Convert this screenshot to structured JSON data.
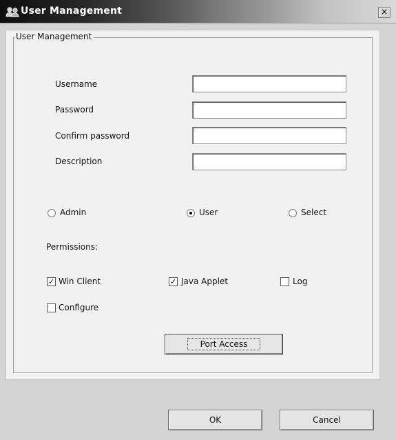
{
  "window": {
    "title": "User Management",
    "close_glyph": "×",
    "icon": "users-icon"
  },
  "group": {
    "legend": "User Management"
  },
  "fields": [
    {
      "label": "Username",
      "value": ""
    },
    {
      "label": "Password",
      "value": ""
    },
    {
      "label": "Confirm password",
      "value": ""
    },
    {
      "label": "Description",
      "value": ""
    }
  ],
  "roles": [
    {
      "label": "Admin",
      "selected": false
    },
    {
      "label": "User",
      "selected": true
    },
    {
      "label": "Select",
      "selected": false
    }
  ],
  "permissions": {
    "title": "Permissions:",
    "items": [
      {
        "label": "Win Client",
        "checked": true
      },
      {
        "label": "Java Applet",
        "checked": true
      },
      {
        "label": "Log",
        "checked": false
      },
      {
        "label": "Configure",
        "checked": false
      }
    ]
  },
  "port_access_label": "Port Access",
  "buttons": {
    "ok": "OK",
    "cancel": "Cancel"
  },
  "check_glyph": "✓"
}
